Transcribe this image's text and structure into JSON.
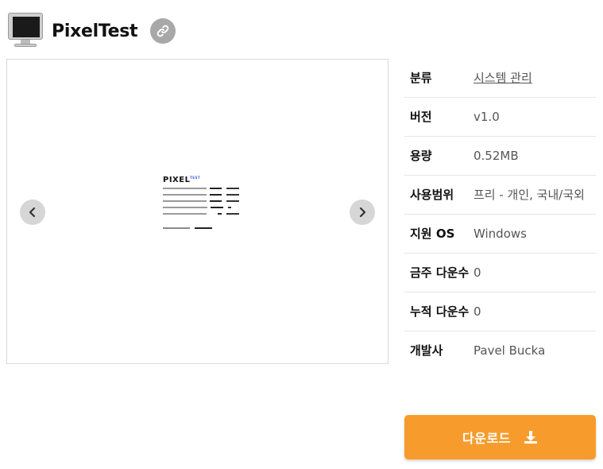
{
  "app": {
    "title": "PixelTest",
    "icon": "monitor-icon"
  },
  "header": {
    "link_icon": "link-icon"
  },
  "gallery": {
    "prev_icon": "chevron-left-icon",
    "next_icon": "chevron-right-icon",
    "preview_logo": "PIXEL",
    "preview_logo_sup": "TEST"
  },
  "info": [
    {
      "label": "분류",
      "value": "시스템 관리"
    },
    {
      "label": "버전",
      "value": "v1.0"
    },
    {
      "label": "용량",
      "value": "0.52MB"
    },
    {
      "label": "사용범위",
      "value": "프리 - 개인, 국내/국외"
    },
    {
      "label": "지원 OS",
      "value": "Windows"
    },
    {
      "label": "금주 다운수",
      "value": "0"
    },
    {
      "label": "누적 다운수",
      "value": "0"
    },
    {
      "label": "개발사",
      "value": "Pavel Bucka"
    }
  ],
  "download": {
    "label": "다운로드",
    "icon": "download-icon"
  },
  "colors": {
    "accent": "#f79c2c",
    "link_btn_bg": "#a8a8a8",
    "nav_btn_bg": "#d6d6d6"
  }
}
